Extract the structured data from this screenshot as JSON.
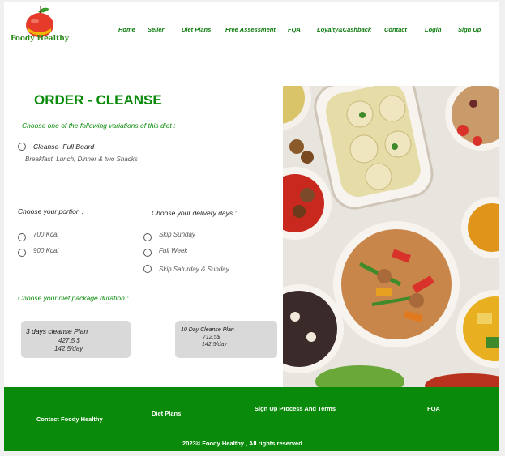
{
  "brand": {
    "name": "Foody Healthy"
  },
  "nav": {
    "home": "Home",
    "seller": "Seller",
    "diet_plans": "Diet Plans",
    "free_assessment": "Free Assessment",
    "fqa": "FQA",
    "loyalty": "Loyalty&Cashback",
    "contact": "Contact",
    "login": "Login",
    "signup": "Sign Up"
  },
  "order": {
    "title": "ORDER - CLEANSE",
    "variation_prompt": "Choose one of the following variations of this diet :",
    "variation": {
      "label": "Cleanse- Full Board",
      "desc": "Breakfast, Lunch, Dinner & two Snacks"
    },
    "portion_prompt": "Choose your portion :",
    "portions": [
      "700 Kcal",
      "900 Kcal"
    ],
    "delivery_prompt": "Choose your delivery days :",
    "delivery": [
      "Skip Sunday",
      "Full Week",
      "Skip Saturday & Sunday"
    ],
    "duration_prompt": "Choose your diet package duration :",
    "packages": [
      {
        "title": "3 days  cleanse Plan",
        "price": "427.5 $",
        "per_day": "142.5/day"
      },
      {
        "title": "10 Day Cleanse Plan",
        "price": "712.5$",
        "per_day": "142.5/day"
      }
    ]
  },
  "footer": {
    "contact": "Contact Foody Healthy",
    "diet_plans": "Diet Plans",
    "signup_terms": "Sign Up Process And Terms",
    "fqa": "FQA",
    "copyright": "2023© Foody Healthy , All rights reserved"
  },
  "colors": {
    "brand_green": "#0a8a0a",
    "package_gray": "#d9d9d9"
  }
}
